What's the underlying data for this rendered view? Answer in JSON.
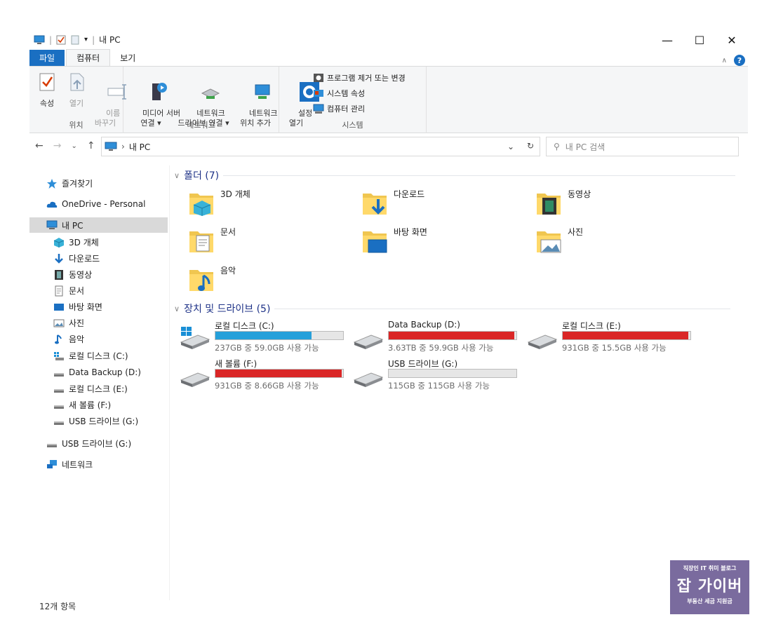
{
  "window": {
    "title": "내 PC",
    "minimize": "—",
    "maximize": "☐",
    "close": "✕"
  },
  "ribbon": {
    "tabs": [
      {
        "label": "파일",
        "kind": "file"
      },
      {
        "label": "컴퓨터",
        "kind": "active"
      },
      {
        "label": "보기",
        "kind": "normal"
      }
    ],
    "groups": {
      "location": {
        "label": "위치",
        "properties": "속성",
        "open": "열기",
        "rename": "이름\n바꾸기"
      },
      "network": {
        "label": "네트워크",
        "media_server": "미디어 서버\n연결 ▾",
        "map_drive": "네트워크\n드라이브 연결 ▾",
        "add_location": "네트워크\n위치 추가"
      },
      "system": {
        "label": "시스템",
        "settings": "설정\n열기",
        "uninstall": "프로그램 제거 또는 변경",
        "system_props": "시스템 속성",
        "manage": "컴퓨터 관리"
      }
    }
  },
  "address": {
    "path": "내 PC",
    "search_placeholder": "내 PC 검색"
  },
  "sidebar": {
    "items": [
      {
        "label": "즐겨찾기",
        "icon": "star-icon",
        "indent": 0,
        "selected": false
      },
      {
        "label": "OneDrive - Personal",
        "icon": "cloud-icon",
        "indent": 0,
        "selected": false
      },
      {
        "label": "내 PC",
        "icon": "computer-icon",
        "indent": 0,
        "selected": true
      },
      {
        "label": "3D 개체",
        "icon": "cube-icon",
        "indent": 1,
        "selected": false
      },
      {
        "label": "다운로드",
        "icon": "download-arrow-icon",
        "indent": 1,
        "selected": false
      },
      {
        "label": "동영상",
        "icon": "film-icon",
        "indent": 1,
        "selected": false
      },
      {
        "label": "문서",
        "icon": "document-icon",
        "indent": 1,
        "selected": false
      },
      {
        "label": "바탕 화면",
        "icon": "desktop-icon",
        "indent": 1,
        "selected": false
      },
      {
        "label": "사진",
        "icon": "picture-icon",
        "indent": 1,
        "selected": false
      },
      {
        "label": "음악",
        "icon": "music-note-icon",
        "indent": 1,
        "selected": false
      },
      {
        "label": "로컬 디스크 (C:)",
        "icon": "windows-drive-icon",
        "indent": 1,
        "selected": false
      },
      {
        "label": "Data Backup (D:)",
        "icon": "drive-icon",
        "indent": 1,
        "selected": false
      },
      {
        "label": "로컬 디스크 (E:)",
        "icon": "drive-icon",
        "indent": 1,
        "selected": false
      },
      {
        "label": "새 볼륨 (F:)",
        "icon": "drive-icon",
        "indent": 1,
        "selected": false
      },
      {
        "label": "USB 드라이브 (G:)",
        "icon": "drive-icon",
        "indent": 1,
        "selected": false
      },
      {
        "label": "USB 드라이브 (G:)",
        "icon": "drive-icon",
        "indent": 0,
        "selected": false
      },
      {
        "label": "네트워크",
        "icon": "network-icon",
        "indent": 0,
        "selected": false
      }
    ]
  },
  "folders": {
    "header": "폴더 (7)",
    "items": [
      {
        "label": "3D 개체",
        "icon": "folder-3d-icon"
      },
      {
        "label": "다운로드",
        "icon": "folder-download-icon"
      },
      {
        "label": "동영상",
        "icon": "folder-video-icon"
      },
      {
        "label": "문서",
        "icon": "folder-documents-icon"
      },
      {
        "label": "바탕 화면",
        "icon": "folder-desktop-icon"
      },
      {
        "label": "사진",
        "icon": "folder-pictures-icon"
      },
      {
        "label": "음악",
        "icon": "folder-music-icon"
      }
    ]
  },
  "drives": {
    "header": "장치 및 드라이브 (5)",
    "items": [
      {
        "label": "로컬 디스크 (C:)",
        "free": "237GB 중 59.0GB 사용 가능",
        "used_fraction": 0.75,
        "color": "#26a0da",
        "icon": "windows-drive-icon"
      },
      {
        "label": "Data Backup (D:)",
        "free": "3.63TB 중 59.9GB 사용 가능",
        "used_fraction": 0.984,
        "color": "#da2626",
        "icon": "drive-icon"
      },
      {
        "label": "로컬 디스크 (E:)",
        "free": "931GB 중 15.5GB 사용 가능",
        "used_fraction": 0.983,
        "color": "#da2626",
        "icon": "drive-icon"
      },
      {
        "label": "새 볼륨 (F:)",
        "free": "931GB 중 8.66GB 사용 가능",
        "used_fraction": 0.991,
        "color": "#da2626",
        "icon": "drive-icon"
      },
      {
        "label": "USB 드라이브 (G:)",
        "free": "115GB 중 115GB 사용 가능",
        "used_fraction": 0.0,
        "color": "#26a0da",
        "icon": "drive-icon"
      }
    ]
  },
  "status": {
    "count": "12개 항목"
  },
  "watermark": {
    "line1": "직장인 IT 취미 블로그",
    "line2": "잡 가이버",
    "line3": "부동산 세금 지원금"
  }
}
